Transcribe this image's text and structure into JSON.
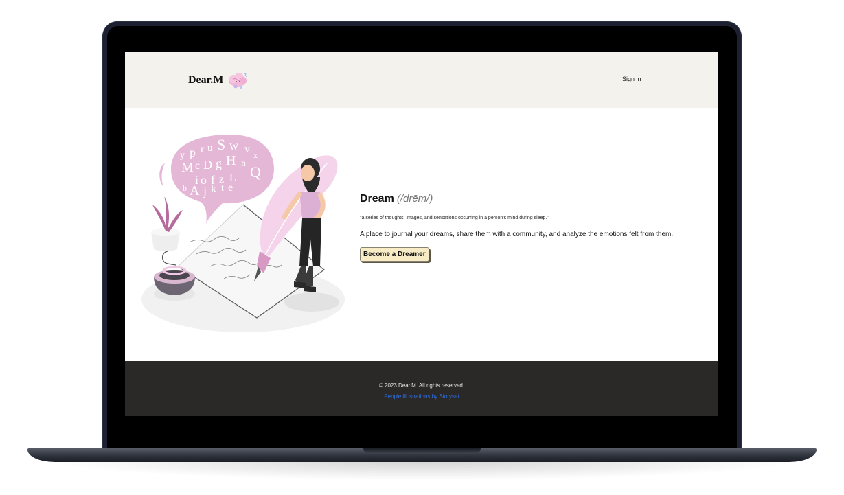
{
  "header": {
    "brand": "Dear.M",
    "brand_icon": "cloud-brain-icon",
    "sign_in": "Sign in"
  },
  "hero": {
    "illustration": "woman-writing-journal-illustration",
    "title": "Dream",
    "pronunciation": "(/drēm/)",
    "definition": "\"a series of thoughts, images, and sensations occurring in a person's mind during sleep.\"",
    "tagline": "A place to journal your dreams, share them with a community, and analyze the emotions felt from them.",
    "cta_label": "Become a Dreamer"
  },
  "footer": {
    "copyright": "© 2023 Dear.M. All rights reserved.",
    "credit_link": "People illustrations by Storyset"
  },
  "colors": {
    "header_bg": "#f3f2ec",
    "footer_bg": "#2a2928",
    "accent_pink": "#e2b2d8",
    "cta_bg": "#f8ecc7",
    "link_blue": "#2f6fe0"
  }
}
